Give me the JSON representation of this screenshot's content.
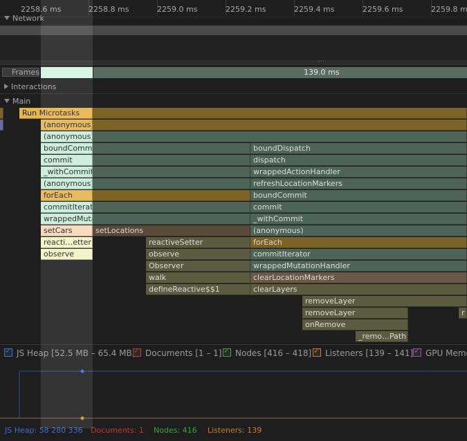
{
  "ruler": {
    "ticks": [
      "2258.6 ms",
      "2258.8 ms",
      "2259.0 ms",
      "2259.2 ms",
      "2259.4 ms",
      "2259.6 ms",
      "2259.8 ms"
    ]
  },
  "sections": {
    "network": "Network",
    "frames": "Frames",
    "frames_duration": "139.0 ms",
    "interactions": "Interactions",
    "main": "Main",
    "more_dots": "..."
  },
  "flame": {
    "run_microtasks": "Run Microtasks",
    "anonymous": "(anonymous)",
    "boundCommit": "boundCommit",
    "commit": "commit",
    "withCommit": "_withCommit",
    "forEach": "forEach",
    "commitIterator": "commitIterator",
    "wrappedMutationHandler": "wrappedMutationHandler",
    "setCars": "setCars",
    "setLocations": "setLocations",
    "reactiveSetter_short": "reacti…etter",
    "observe": "observe",
    "reactiveSetter": "reactiveSetter",
    "Observer": "Observer",
    "walk": "walk",
    "defineReactive": "defineReactive$$1",
    "boundDispatch": "boundDispatch",
    "dispatch": "dispatch",
    "wrappedActionHandler": "wrappedActionHandler",
    "refreshLocationMarkers": "refreshLocationMarkers",
    "clearLocationMarkers": "clearLocationMarkers",
    "clearLayers": "clearLayers",
    "removeLayer": "removeLayer",
    "onRemove": "onRemove",
    "removePath": "_remo…Path",
    "truncated_r": "r"
  },
  "legend": {
    "js_heap": "JS Heap [52.5 MB – 65.4 MB]",
    "documents": "Documents [1 – 1]",
    "nodes": "Nodes [416 – 418]",
    "listeners": "Listeners [139 – 141]",
    "gpu": "GPU Memo"
  },
  "status": {
    "js_heap": "JS Heap: 58 280 336",
    "documents": "Documents: 1",
    "nodes": "Nodes: 416",
    "listeners": "Listeners: 139"
  },
  "colors": {
    "js_heap": "#3b6fd6",
    "documents": "#c0392b",
    "nodes": "#3aa53a",
    "listeners": "#c77d2a",
    "gpu": "#a04ab0"
  }
}
